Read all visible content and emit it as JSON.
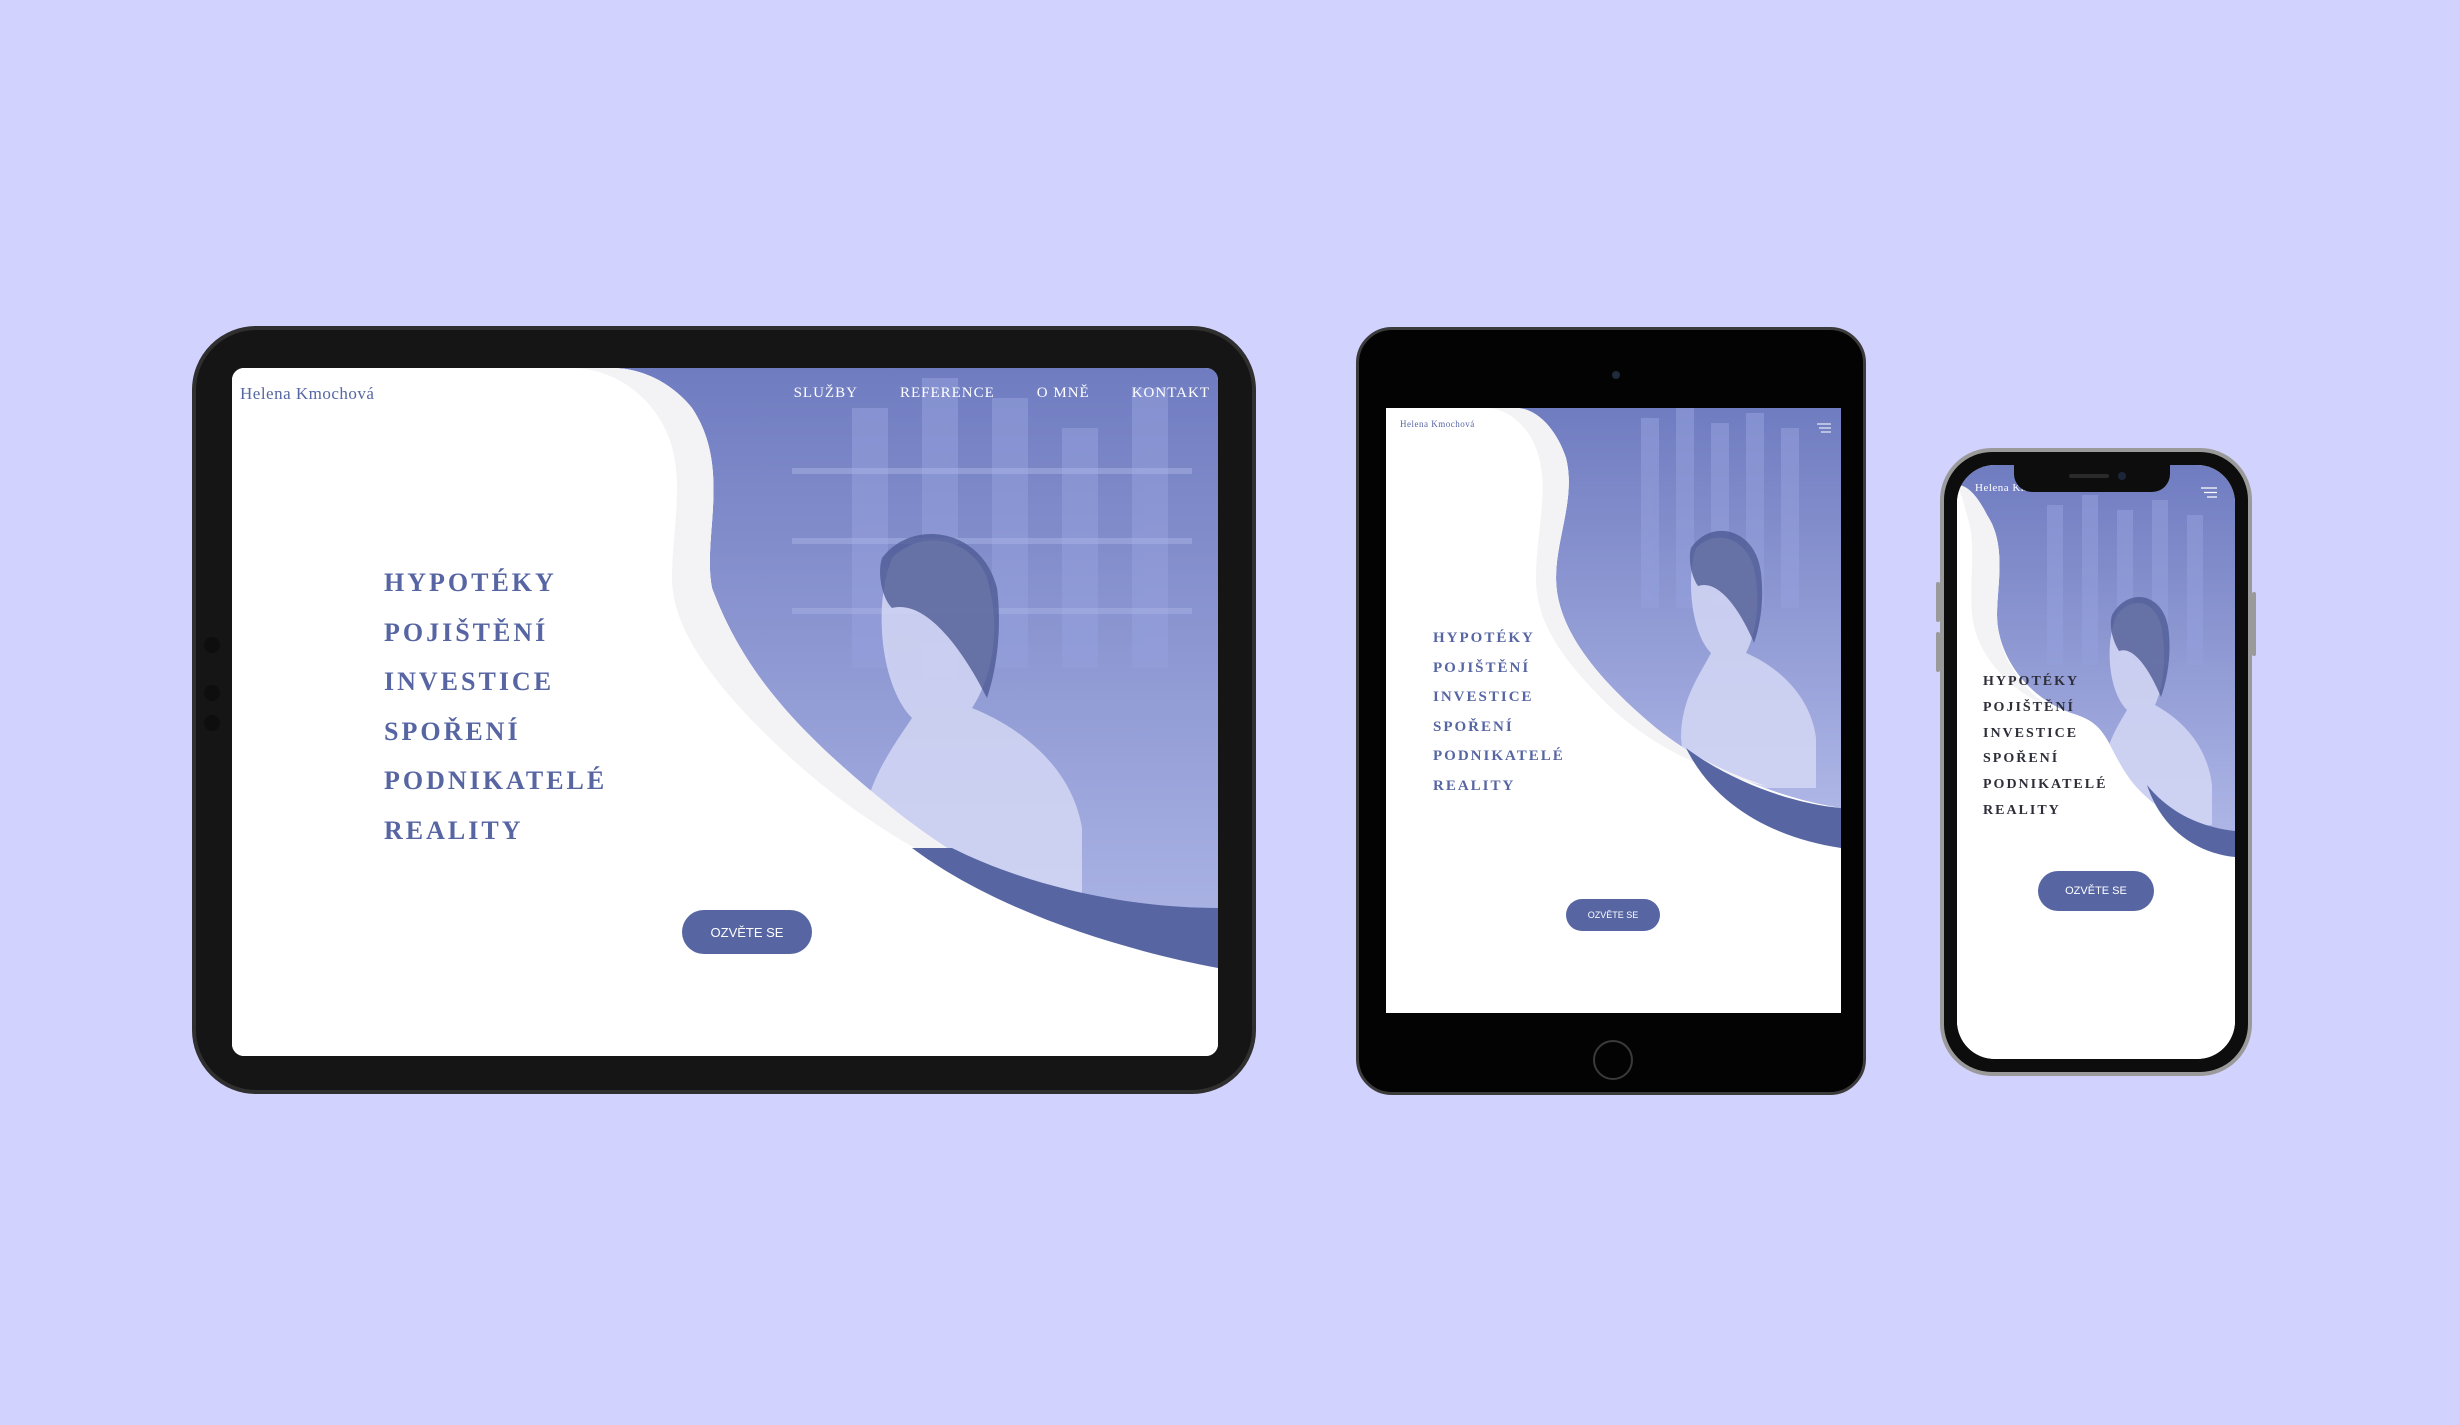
{
  "site": {
    "logo": "Helena Kmochová",
    "nav": [
      "SLUŽBY",
      "REFERENCE",
      "O MNĚ",
      "KONTAKT"
    ],
    "services": [
      "HYPOTÉKY",
      "POJIŠTĚNÍ",
      "INVESTICE",
      "SPOŘENÍ",
      "PODNIKATELÉ",
      "REALITY"
    ],
    "cta": "OZVĚTE SE"
  },
  "colors": {
    "background": "#d2d2fe",
    "accent": "#5766a3",
    "hero_tint": "#8b96d4",
    "text_dark": "#2e2e39"
  },
  "icons": {
    "menu": "hamburger-menu-icon"
  }
}
